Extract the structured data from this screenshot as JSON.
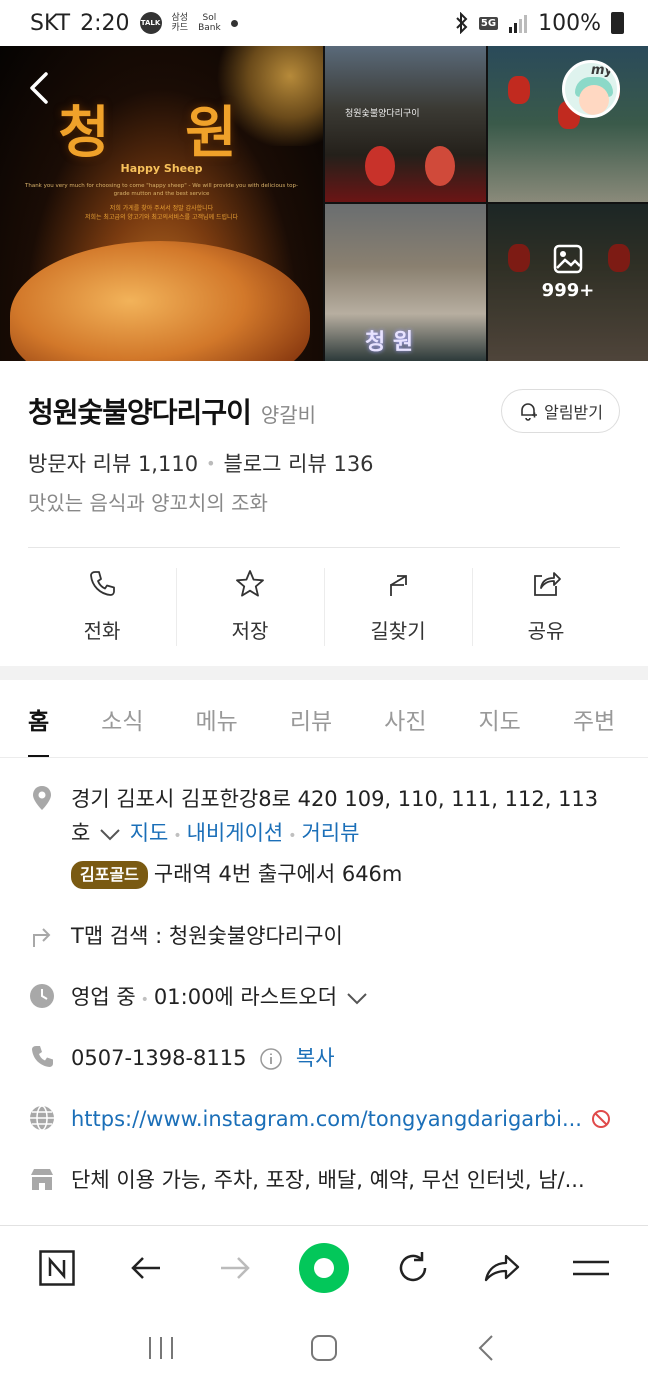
{
  "status_bar": {
    "carrier": "SKT",
    "time": "2:20",
    "talk_label": "TALK",
    "card_label": "삼성\n카드",
    "bank_label": "Sol\nBank",
    "network": "5G",
    "battery": "100%"
  },
  "gallery": {
    "main_title": "청 원",
    "main_sub": "Happy Sheep",
    "main_tagline": "Thank you very much for choosing to come \"happy sheep\" - We will provide you with delicious top-grade mutton and the best service",
    "main_note": "저희 가게를 찾아 주셔서 정말 감사합니다\n저희는 최고급의 양고기와 최고의서비스를 고객님께 드립니다",
    "tile1_sign": "청원숯불양다리구이",
    "tile3_sign": "청 원",
    "more_count": "999+",
    "avatar_tag": "my"
  },
  "place": {
    "name": "청원숯불양다리구이",
    "category": "양갈비",
    "alarm_label": "알림받기",
    "visitor_reviews": "방문자 리뷰 1,110",
    "blog_reviews": "블로그 리뷰 136",
    "description": "맛있는 음식과 양꼬치의 조화"
  },
  "actions": [
    {
      "label": "전화",
      "icon": "phone-icon"
    },
    {
      "label": "저장",
      "icon": "star-icon"
    },
    {
      "label": "길찾기",
      "icon": "directions-icon"
    },
    {
      "label": "공유",
      "icon": "share-icon"
    }
  ],
  "tabs": [
    "홈",
    "소식",
    "메뉴",
    "리뷰",
    "사진",
    "지도",
    "주변"
  ],
  "info": {
    "address_line1": "경기 김포시 김포한강8로 420 109, 110, 111, 112, 113",
    "address_line2_prefix": "호",
    "address_link_map": "지도",
    "address_link_nav": "내비게이션",
    "address_link_street": "거리뷰",
    "transit_badge": "김포골드",
    "transit_text": "구래역 4번 출구에서 646m",
    "tmap_text": "T맵 검색 : 청원숯불양다리구이",
    "hours_status": "영업 중",
    "hours_detail": "01:00에 라스트오더",
    "phone": "0507-1398-8115",
    "copy_label": "복사",
    "website": "https://www.instagram.com/tongyangdarigarbi...",
    "amenities": "단체 이용 가능, 주차, 포장, 배달, 예약, 무선 인터넷, 남/..."
  },
  "colors": {
    "accent_green": "#03c75a",
    "link_blue": "#1b6fb8",
    "badge_gold": "#7a5a12"
  }
}
